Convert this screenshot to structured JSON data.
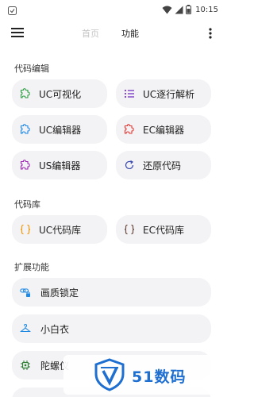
{
  "status_bar": {
    "time": "10:15"
  },
  "app_bar": {
    "tabs": [
      {
        "label": "首页",
        "active": false
      },
      {
        "label": "功能",
        "active": true
      }
    ]
  },
  "sections": [
    {
      "title": "代码编辑",
      "items": [
        {
          "label": "UC可视化",
          "icon": "puzzle-icon",
          "color": "#2e9e45"
        },
        {
          "label": "UC逐行解析",
          "icon": "list-icon",
          "color": "#7d3cc8"
        },
        {
          "label": "UC编辑器",
          "icon": "puzzle-icon",
          "color": "#1e88e5"
        },
        {
          "label": "EC编辑器",
          "icon": "puzzle-icon",
          "color": "#e53935"
        },
        {
          "label": "US编辑器",
          "icon": "puzzle-icon",
          "color": "#9c27b0"
        },
        {
          "label": "还原代码",
          "icon": "refresh-icon",
          "color": "#3949ab"
        }
      ]
    },
    {
      "title": "代码库",
      "items": [
        {
          "label": "UC代码库",
          "icon": "braces-icon",
          "color": "#f39c12"
        },
        {
          "label": "EC代码库",
          "icon": "braces-icon",
          "color": "#6d4c41"
        }
      ]
    },
    {
      "title": "扩展功能",
      "items": [
        {
          "label": "画质锁定",
          "icon": "link-lock-icon",
          "color": "#1e88e5"
        },
        {
          "label": "小白衣",
          "icon": "hanger-icon",
          "color": "#1e88e5"
        },
        {
          "label": "陀螺仪",
          "icon": "chip-icon",
          "color": "#2e7d32"
        }
      ]
    }
  ],
  "watermark": {
    "text": "51数码",
    "color": "#1e6fd0"
  }
}
